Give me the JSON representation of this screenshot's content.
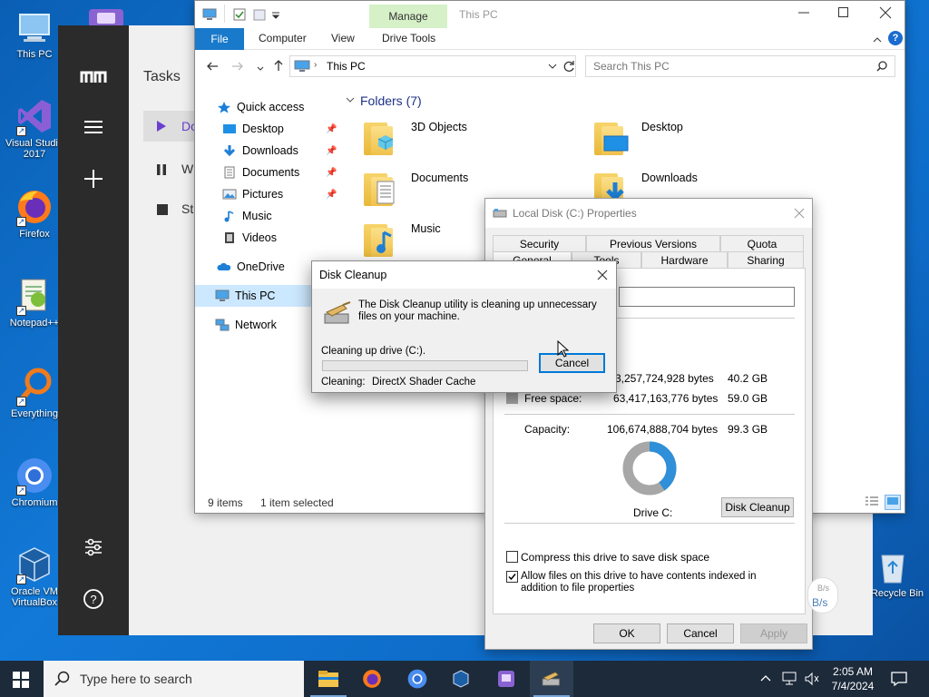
{
  "desktop": {
    "icons": [
      {
        "label": "This PC"
      },
      {
        "label": "Visual Studio 2017"
      },
      {
        "label": "Firefox"
      },
      {
        "label": "Notepad++"
      },
      {
        "label": "Everything"
      },
      {
        "label": "Chromium"
      },
      {
        "label": "Oracle VM VirtualBox"
      },
      {
        "label": "Recycle Bin"
      }
    ]
  },
  "side_panel": {
    "title": "Tasks",
    "items": [
      "Do",
      "W",
      "St"
    ]
  },
  "explorer": {
    "title": "This PC",
    "manage_tab": "Manage",
    "ribbon_tabs": {
      "file": "File",
      "computer": "Computer",
      "view": "View",
      "drive_tools": "Drive Tools"
    },
    "address": "This PC",
    "search_placeholder": "Search This PC",
    "nav": {
      "quick_access": "Quick access",
      "desktop": "Desktop",
      "downloads": "Downloads",
      "documents": "Documents",
      "pictures": "Pictures",
      "music": "Music",
      "videos": "Videos",
      "onedrive": "OneDrive",
      "this_pc": "This PC",
      "network": "Network"
    },
    "folders_header": "Folders (7)",
    "folders": [
      "3D Objects",
      "Desktop",
      "Documents",
      "Downloads",
      "Music"
    ],
    "status": {
      "items": "9 items",
      "selected": "1 item selected"
    }
  },
  "properties": {
    "title": "Local Disk (C:) Properties",
    "tabs_row1": [
      "Security",
      "Previous Versions",
      "Quota"
    ],
    "tabs_row2": [
      "General",
      "Tools",
      "Hardware",
      "Sharing"
    ],
    "used": {
      "bytes": "3,257,724,928 bytes",
      "size": "40.2 GB"
    },
    "free": {
      "label": "Free space:",
      "bytes": "63,417,163,776 bytes",
      "size": "59.0 GB"
    },
    "capacity": {
      "label": "Capacity:",
      "bytes": "106,674,888,704 bytes",
      "size": "99.3 GB"
    },
    "used_fraction": 0.405,
    "drive_label": "Drive C:",
    "disk_cleanup_button": "Disk Cleanup",
    "compress_label": "Compress this drive to save disk space",
    "index_label": "Allow files on this drive to have contents indexed in addition to file properties",
    "compress_checked": false,
    "index_checked": true,
    "ok": "OK",
    "cancel": "Cancel",
    "apply": "Apply",
    "colors": {
      "used": "#2f8fd8",
      "free": "#a7a7a7"
    }
  },
  "cleanup": {
    "title": "Disk Cleanup",
    "message": "The Disk Cleanup utility is cleaning up unnecessary files on your machine.",
    "progress_label": "Cleaning up drive  (C:).",
    "cancel": "Cancel",
    "cleaning_label": "Cleaning:",
    "cleaning_item": "DirectX Shader Cache",
    "progress": 0
  },
  "network_widget": {
    "line1": "B/s",
    "line2": "B/s"
  },
  "taskbar": {
    "search_placeholder": "Type here to search",
    "time": "2:05 AM",
    "date": "7/4/2024"
  }
}
